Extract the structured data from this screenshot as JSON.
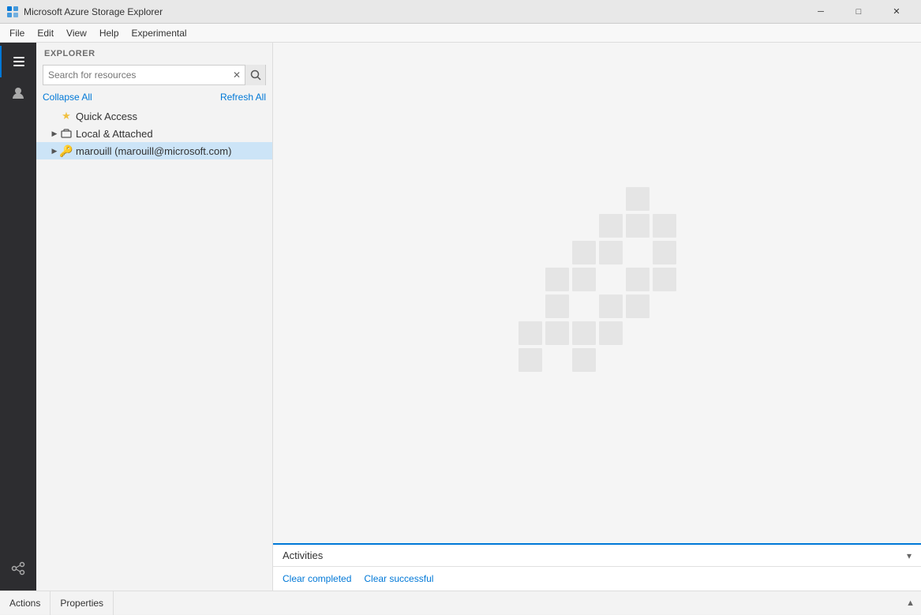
{
  "app": {
    "title": "Microsoft Azure Storage Explorer",
    "icon": "🗄️"
  },
  "titlebar": {
    "minimize_label": "─",
    "maximize_label": "□",
    "close_label": "✕"
  },
  "menu": {
    "items": [
      "File",
      "Edit",
      "View",
      "Help",
      "Experimental"
    ]
  },
  "sidebar": {
    "icons": [
      {
        "name": "explorer-icon",
        "glyph": "≡",
        "active": true
      },
      {
        "name": "account-icon",
        "glyph": "👤",
        "active": false
      },
      {
        "name": "connect-icon",
        "glyph": "🔌",
        "active": false
      }
    ]
  },
  "explorer": {
    "header": "EXPLORER",
    "search_placeholder": "Search for resources",
    "collapse_all_label": "Collapse All",
    "refresh_all_label": "Refresh All",
    "tree": [
      {
        "id": "quick-access",
        "label": "Quick Access",
        "icon": "★",
        "icon_color": "#f0c040",
        "indent": 1,
        "arrow": "",
        "has_arrow": false
      },
      {
        "id": "local-attached",
        "label": "Local & Attached",
        "icon": "🔗",
        "indent": 1,
        "has_arrow": true,
        "expanded": false
      },
      {
        "id": "marouill",
        "label": "marouill (marouill@microsoft.com)",
        "icon": "🔑",
        "icon_color": "#f0c040",
        "indent": 1,
        "has_arrow": true,
        "expanded": false,
        "selected": true
      }
    ]
  },
  "activities": {
    "title": "Activities",
    "clear_completed_label": "Clear completed",
    "clear_successful_label": "Clear successful"
  },
  "bottom_bar": {
    "actions_label": "Actions",
    "properties_label": "Properties"
  },
  "blocks_layout": [
    [
      0,
      0,
      0,
      0,
      1,
      0
    ],
    [
      0,
      0,
      0,
      1,
      1,
      1
    ],
    [
      0,
      0,
      1,
      1,
      0,
      1
    ],
    [
      0,
      1,
      1,
      0,
      1,
      1
    ],
    [
      0,
      1,
      0,
      1,
      1,
      0
    ],
    [
      1,
      1,
      1,
      1,
      0,
      0
    ],
    [
      1,
      0,
      1,
      0,
      0,
      0
    ],
    [
      0,
      0,
      0,
      0,
      0,
      0
    ]
  ]
}
